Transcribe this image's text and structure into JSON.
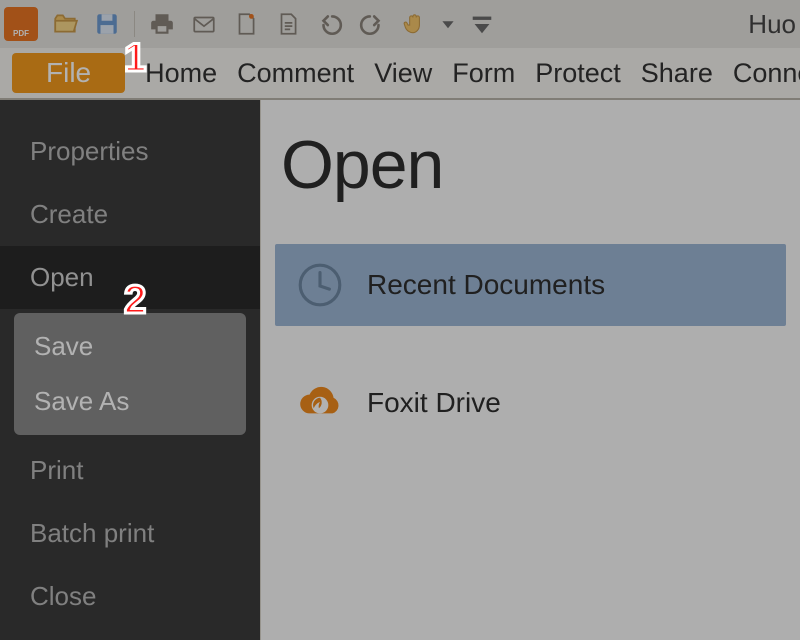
{
  "app": {
    "username_partial": "Huo"
  },
  "qat": {
    "icons": [
      "pdf-app",
      "folder-open",
      "save",
      "print",
      "mail",
      "blank-page",
      "typewriter",
      "undo",
      "redo",
      "hand",
      "dropdown",
      "more"
    ]
  },
  "tabs": {
    "file": "File",
    "items": [
      "Home",
      "Comment",
      "View",
      "Form",
      "Protect",
      "Share",
      "Connect"
    ]
  },
  "sidebar": {
    "items": [
      {
        "label": "Properties",
        "state": ""
      },
      {
        "label": "Create",
        "state": ""
      },
      {
        "label": "Open",
        "state": "selected"
      },
      {
        "label": "Save",
        "state": "hi"
      },
      {
        "label": "Save As",
        "state": "hi"
      },
      {
        "label": "Print",
        "state": ""
      },
      {
        "label": "Batch print",
        "state": ""
      },
      {
        "label": "Close",
        "state": ""
      }
    ]
  },
  "content": {
    "heading": "Open",
    "locations": [
      {
        "icon": "clock",
        "label": "Recent Documents",
        "selected": true
      },
      {
        "icon": "foxit-cloud",
        "label": "Foxit Drive",
        "selected": false
      }
    ]
  },
  "callouts": {
    "one": "1",
    "two": "2"
  },
  "colors": {
    "accent": "#f39a1e",
    "sidebar_bg": "#3b3b3b",
    "selection_blue": "#9db7d4",
    "callout_red": "#ff1a1a",
    "foxit_orange": "#f08a1d"
  }
}
